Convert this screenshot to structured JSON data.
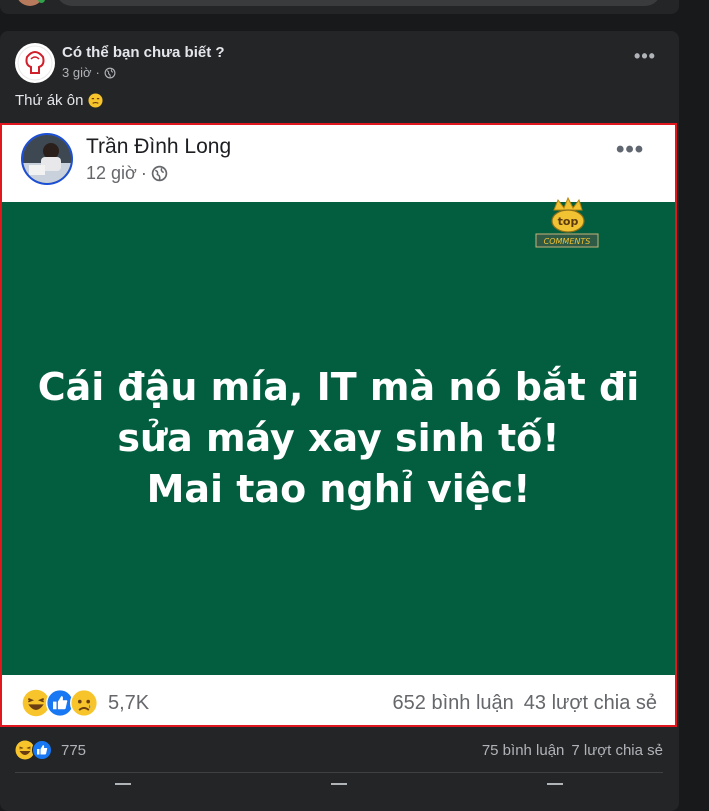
{
  "post": {
    "author": "Có thể bạn chưa biết ?",
    "time": "3 giờ",
    "caption": "Thứ ák ôn",
    "more": "•••"
  },
  "shared": {
    "author": "Trần Đình Long",
    "time": "12 giờ",
    "more": "•••",
    "quote_lines": [
      "Cái đậu mía, IT mà nó bắt đi",
      "sửa máy xay sinh tố!",
      "Mai tao nghỉ việc!"
    ],
    "watermark_text": "top COMMENTS",
    "reactions_count": "5,7K",
    "comments": "652 bình luận",
    "shares": "43 lượt chia sẻ",
    "body_color": "#035e40",
    "highlight_color": "#e0171f"
  },
  "footer": {
    "reactions_count": "775",
    "comments": "75 bình luận",
    "shares": "7 lượt chia sẻ",
    "reaction_icons": [
      "haha-icon",
      "like-icon"
    ]
  },
  "colors": {
    "card_bg": "#242526",
    "page_bg": "#18191a",
    "text_primary": "#e4e6eb",
    "text_secondary": "#b0b3b8",
    "like_blue": "#1877f2"
  }
}
